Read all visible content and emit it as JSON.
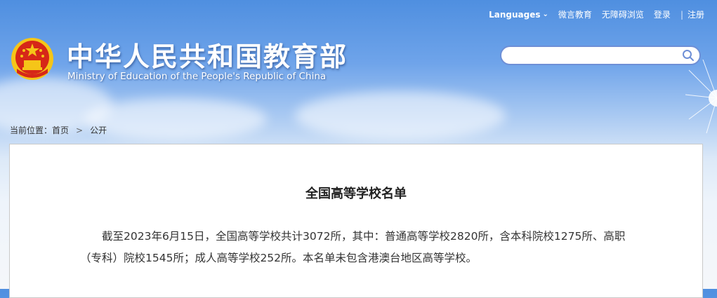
{
  "header": {
    "title_cn": "中华人民共和国教育部",
    "title_en": "Ministry of Education of the People's Republic of China",
    "emblem_icon": "national-emblem-icon"
  },
  "topnav": {
    "languages": "Languages",
    "weibo": "微言教育",
    "accessibility": "无障碍浏览",
    "login": "登录",
    "register": "注册",
    "separator": "|"
  },
  "search": {
    "placeholder": "",
    "value": "",
    "icon": "search-icon"
  },
  "breadcrumb": {
    "prefix": "当前位置：",
    "home": "首页",
    "current": "公开"
  },
  "article": {
    "title": "全国高等学校名单",
    "paragraph": "截至2023年6月15日，全国高等学校共计3072所，其中：普通高等学校2820所，含本科院校1275所、高职（专科）院校1545所；成人高等学校252所。本名单未包含港澳台地区高等学校。"
  },
  "colors": {
    "accent": "#6e8fd6",
    "emblem_red": "#d62718",
    "emblem_gold": "#f5c518"
  }
}
